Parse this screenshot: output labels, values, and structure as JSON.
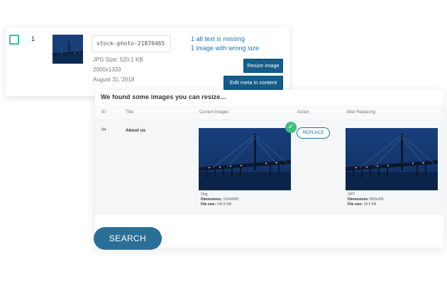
{
  "colors": {
    "accent": "#155d8a",
    "teal": "#3fbfa1",
    "link": "#1f76b5",
    "success": "#3fbf7f",
    "photo_sky": "#1a3f7a"
  },
  "media_row": {
    "index": "1",
    "filename": "stock-photo-21870465",
    "file_size": "JPG Size: 520.1 KB",
    "dimensions": "2000x1333",
    "date": "August 31, 2018",
    "issues": [
      "1 alt text is missing",
      "1 image with wrong size"
    ],
    "resize_label": "Resize image",
    "edit_meta_label": "Edit meta in content"
  },
  "panel": {
    "title": "We found some images you can resize...",
    "headers": {
      "id": "ID",
      "title": "Title",
      "current": "Current Images",
      "action": "Action",
      "after": "After Replacing"
    },
    "row": {
      "id": "94",
      "title": "About us",
      "replace_label": "REPLACE",
      "current": {
        "label": "Orig",
        "dimensions_key": "Dimensions:",
        "dimensions": "1024x682",
        "filesize_key": "File size:",
        "filesize": "140.5 KB"
      },
      "after": {
        "label": "OPT",
        "dimensions_key": "Dimensions:",
        "dimensions": "850x439",
        "filesize_key": "File size:",
        "filesize": "18.9 KB"
      }
    }
  },
  "search_label": "SEARCH",
  "icons": {
    "checkbox": "checkbox-icon",
    "check": "check-icon"
  }
}
